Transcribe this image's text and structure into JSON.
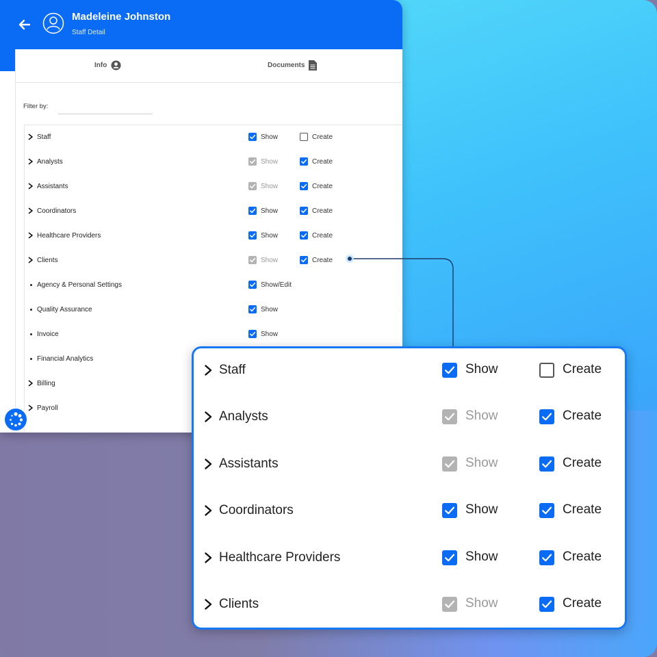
{
  "header": {
    "title": "Madeleine Johnston",
    "subtitle": "Staff Detail"
  },
  "tabs": {
    "info": "Info",
    "documents": "Documents"
  },
  "filter": {
    "label": "Filter by:",
    "value": "",
    "placeholder": ""
  },
  "colors": {
    "primary": "#0a6cf5",
    "disabled": "#b3b3b3"
  },
  "permissions": [
    {
      "label": "Staff",
      "type": "group",
      "show_label": "Show",
      "show": "checked",
      "create_label": "Create",
      "create": "unchecked"
    },
    {
      "label": "Analysts",
      "type": "group",
      "show_label": "Show",
      "show": "disabled",
      "create_label": "Create",
      "create": "checked"
    },
    {
      "label": "Assistants",
      "type": "group",
      "show_label": "Show",
      "show": "disabled",
      "create_label": "Create",
      "create": "checked"
    },
    {
      "label": "Coordinators",
      "type": "group",
      "show_label": "Show",
      "show": "checked",
      "create_label": "Create",
      "create": "checked"
    },
    {
      "label": "Healthcare Providers",
      "type": "group",
      "show_label": "Show",
      "show": "checked",
      "create_label": "Create",
      "create": "checked"
    },
    {
      "label": "Clients",
      "type": "group",
      "show_label": "Show",
      "show": "disabled",
      "create_label": "Create",
      "create": "checked"
    },
    {
      "label": "Agency & Personal Settings",
      "type": "item",
      "show_label": "Show/Edit",
      "show": "checked"
    },
    {
      "label": "Quality Assurance",
      "type": "item",
      "show_label": "Show",
      "show": "checked"
    },
    {
      "label": "Invoice",
      "type": "item",
      "show_label": "Show",
      "show": "checked"
    },
    {
      "label": "Financial Analytics",
      "type": "item"
    },
    {
      "label": "Billing",
      "type": "group"
    },
    {
      "label": "Payroll",
      "type": "group"
    }
  ],
  "zoom_permissions": [
    {
      "label": "Staff",
      "show_label": "Show",
      "show": "checked",
      "create_label": "Create",
      "create": "unchecked"
    },
    {
      "label": "Analysts",
      "show_label": "Show",
      "show": "disabled",
      "create_label": "Create",
      "create": "checked"
    },
    {
      "label": "Assistants",
      "show_label": "Show",
      "show": "disabled",
      "create_label": "Create",
      "create": "checked"
    },
    {
      "label": "Coordinators",
      "show_label": "Show",
      "show": "checked",
      "create_label": "Create",
      "create": "checked"
    },
    {
      "label": "Healthcare Providers",
      "show_label": "Show",
      "show": "checked",
      "create_label": "Create",
      "create": "checked"
    },
    {
      "label": "Clients",
      "show_label": "Show",
      "show": "disabled",
      "create_label": "Create",
      "create": "checked"
    }
  ]
}
